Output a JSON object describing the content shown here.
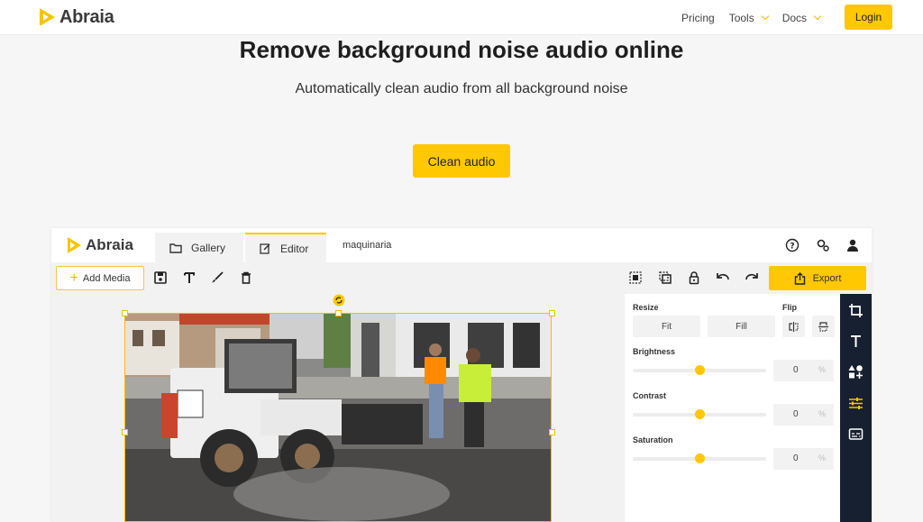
{
  "nav": {
    "brand": "Abraia",
    "links": [
      "Pricing",
      "Tools",
      "Docs"
    ],
    "login": "Login"
  },
  "hero": {
    "title": "Remove background noise audio online",
    "subtitle": "Automatically clean audio from all background noise",
    "cta": "Clean audio"
  },
  "editor": {
    "brand": "Abraia",
    "tabs": [
      "Gallery",
      "Editor"
    ],
    "filename": "maquinaria",
    "toolbar": {
      "add_media": "Add Media",
      "export": "Export"
    },
    "panel": {
      "resize_label": "Resize",
      "flip_label": "Flip",
      "fit": "Fit",
      "fill": "Fill",
      "brightness_label": "Brightness",
      "brightness_value": "0",
      "contrast_label": "Contrast",
      "contrast_value": "0",
      "saturation_label": "Saturation",
      "saturation_value": "0",
      "unit": "%",
      "brightness_level": 0.5,
      "contrast_level": 0.5,
      "saturation_level": 0.5
    }
  },
  "colors": {
    "accent": "#ffc800",
    "rail": "#172030"
  }
}
